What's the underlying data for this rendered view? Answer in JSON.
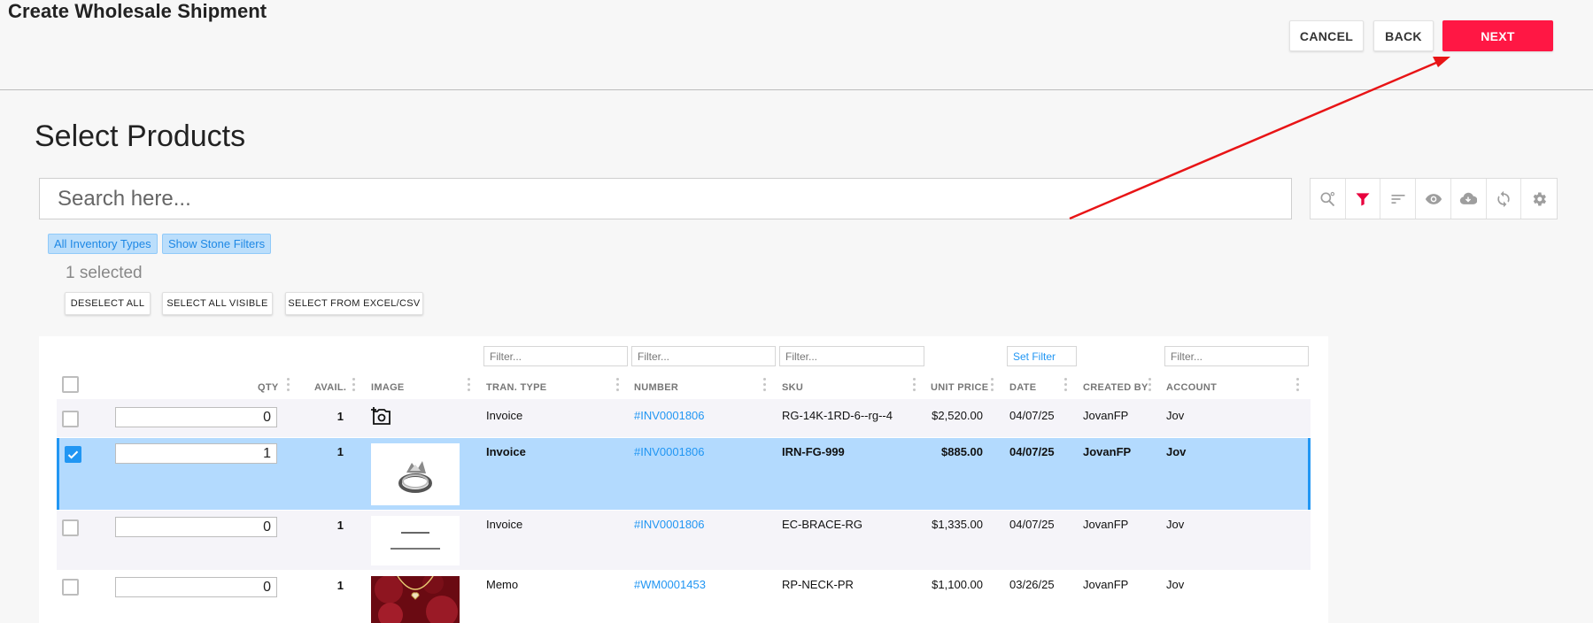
{
  "header": {
    "title": "Create Wholesale Shipment",
    "cancel_label": "CANCEL",
    "back_label": "BACK",
    "next_label": "NEXT"
  },
  "section": {
    "title": "Select Products"
  },
  "search": {
    "placeholder": "Search here..."
  },
  "toolbar": {
    "icons": [
      "search-settings-icon",
      "filter-icon",
      "sort-icon",
      "eye-icon",
      "cloud-download-icon",
      "refresh-icon",
      "gear-icon"
    ],
    "accent": "#e8003d"
  },
  "chips": {
    "inventory_types": "All Inventory Types",
    "stone_filters": "Show Stone Filters"
  },
  "selection": {
    "count_text": "1 selected",
    "deselect_all": "DESELECT ALL",
    "select_all_visible": "SELECT ALL VISIBLE",
    "select_from_excel": "SELECT FROM EXCEL/CSV"
  },
  "filters": {
    "tran_type": "Filter...",
    "number": "Filter...",
    "sku": "Filter...",
    "date": "Set Filter",
    "account": "Filter..."
  },
  "columns": {
    "qty": "QTY",
    "avail": "AVAIL.",
    "image": "IMAGE",
    "tran_type": "TRAN. TYPE",
    "number": "NUMBER",
    "sku": "SKU",
    "unit_price": "UNIT PRICE",
    "date": "DATE",
    "created_by": "CREATED BY",
    "account": "ACCOUNT"
  },
  "rows": [
    {
      "selected": false,
      "qty": "0",
      "avail": "1",
      "image": "add-photo-icon",
      "tran_type": "Invoice",
      "number": "#INV0001806",
      "sku": "RG-14K-1RD-6--rg--4",
      "unit_price": "$2,520.00",
      "date": "04/07/25",
      "created_by": "JovanFP",
      "account": "Jov"
    },
    {
      "selected": true,
      "qty": "1",
      "avail": "1",
      "image": "ring-photo",
      "tran_type": "Invoice",
      "number": "#INV0001806",
      "sku": "IRN-FG-999",
      "unit_price": "$885.00",
      "date": "04/07/25",
      "created_by": "JovanFP",
      "account": "Jov"
    },
    {
      "selected": false,
      "qty": "0",
      "avail": "1",
      "image": "document-photo",
      "tran_type": "Invoice",
      "number": "#INV0001806",
      "sku": "EC-BRACE-RG",
      "unit_price": "$1,335.00",
      "date": "04/07/25",
      "created_by": "JovanFP",
      "account": "Jov"
    },
    {
      "selected": false,
      "qty": "0",
      "avail": "1",
      "image": "necklace-photo",
      "tran_type": "Memo",
      "number": "#WM0001453",
      "sku": "RP-NECK-PR",
      "unit_price": "$1,100.00",
      "date": "03/26/25",
      "created_by": "JovanFP",
      "account": "Jov"
    }
  ],
  "colors": {
    "primary": "#ff1744",
    "link": "#2196f3",
    "selected_row": "#b3dafe"
  }
}
